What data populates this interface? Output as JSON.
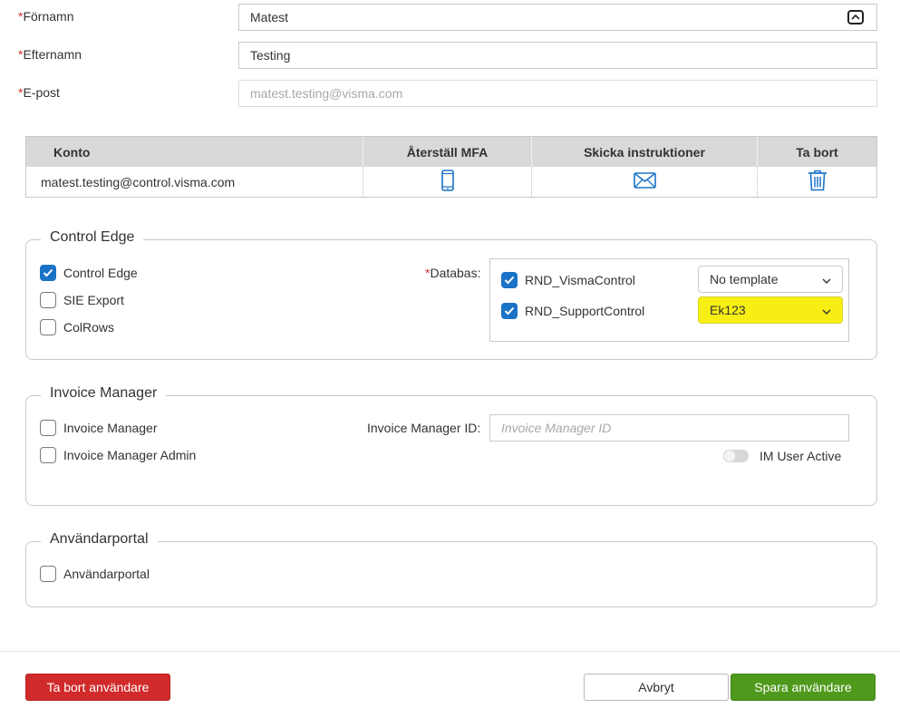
{
  "form": {
    "required_mark": "*",
    "firstname": {
      "label": "Förnamn",
      "value": "Matest"
    },
    "lastname": {
      "label": "Efternamn",
      "value": "Testing"
    },
    "email": {
      "label": "E-post",
      "value": "matest.testing@visma.com"
    }
  },
  "accounts_table": {
    "columns": [
      "Konto",
      "Återställ MFA",
      "Skicka instruktioner",
      "Ta bort"
    ],
    "rows": [
      {
        "account": "matest.testing@control.visma.com"
      }
    ]
  },
  "control_edge": {
    "title": "Control Edge",
    "options": [
      {
        "label": "Control Edge",
        "checked": true
      },
      {
        "label": "SIE Export",
        "checked": false
      },
      {
        "label": "ColRows",
        "checked": false
      }
    ],
    "database_label": "Databas:",
    "databases": [
      {
        "name": "RND_VismaControl",
        "checked": true,
        "template": "No template"
      },
      {
        "name": "RND_SupportControl",
        "checked": true,
        "template": "Ek123"
      }
    ]
  },
  "invoice_manager": {
    "title": "Invoice Manager",
    "options": [
      {
        "label": "Invoice Manager",
        "checked": false
      },
      {
        "label": "Invoice Manager Admin",
        "checked": false
      }
    ],
    "id_label": "Invoice Manager ID:",
    "id_placeholder": "Invoice Manager ID",
    "active_label": "IM User Active"
  },
  "user_portal": {
    "title": "Användarportal",
    "options": [
      {
        "label": "Användarportal",
        "checked": false
      }
    ]
  },
  "footer": {
    "delete_label": "Ta bort användare",
    "cancel_label": "Avbryt",
    "save_label": "Spara användare"
  },
  "colors": {
    "accent": "#1a73c6",
    "danger": "#d12a2a",
    "success": "#4f9a1c",
    "highlight": "#f7ef14"
  }
}
